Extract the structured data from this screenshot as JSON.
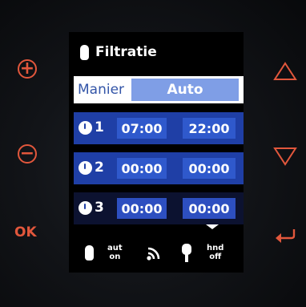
{
  "screen": {
    "title": "Filtratie",
    "mode": {
      "label": "Manier",
      "value": "Auto"
    },
    "schedules": [
      {
        "slot": "1",
        "start": "07:00",
        "end": "22:00"
      },
      {
        "slot": "2",
        "start": "00:00",
        "end": "00:00"
      },
      {
        "slot": "3",
        "start": "00:00",
        "end": "00:00"
      }
    ],
    "status": {
      "auto_line1": "aut",
      "auto_line2": "on",
      "hand_line1": "hnd",
      "hand_line2": "off"
    }
  },
  "buttons": {
    "plus": "+",
    "minus": "−",
    "ok": "OK"
  },
  "colors": {
    "accent": "#e2573c",
    "row_selected": "#1f3fa6",
    "time_box": "#2f59cc",
    "mode_value_bg": "#7f9ee6"
  }
}
